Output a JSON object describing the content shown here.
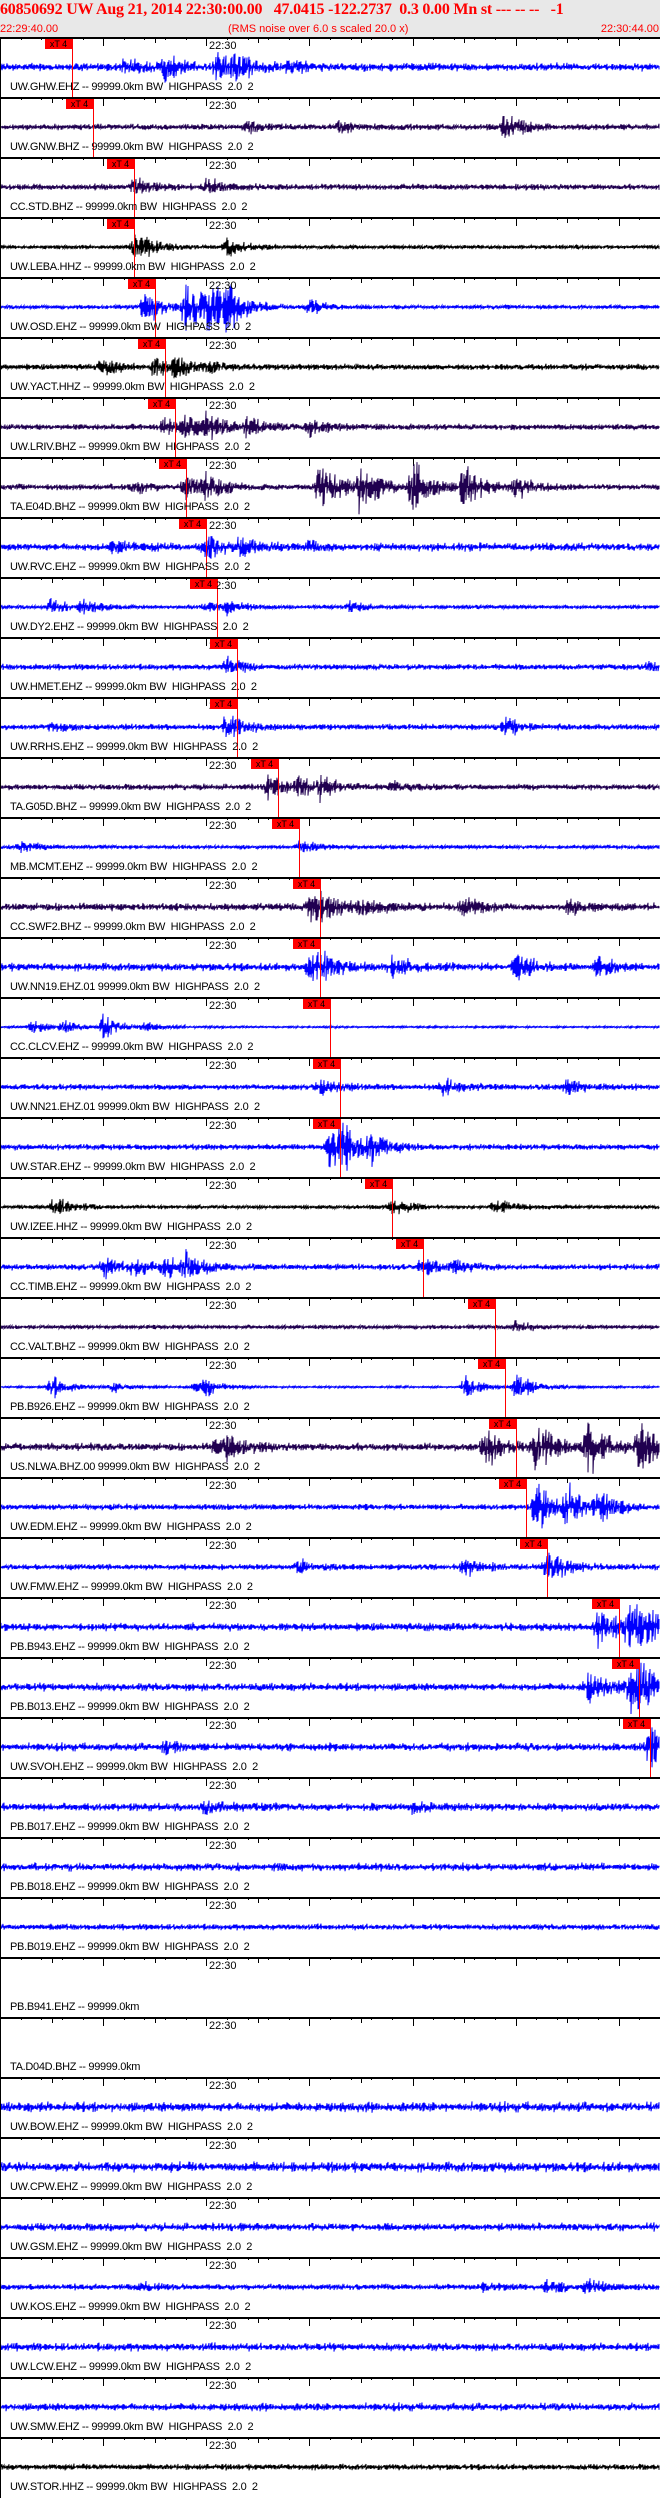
{
  "header": {
    "title": "60850692 UW Aug 21, 2014 22:30:00.00   47.0415 -122.2737  0.3 0.00 Mn st --- -- --   -1",
    "start_time": "22:29:40.00",
    "note": "(RMS noise over 6.0 s scaled 20.0 x)",
    "end_time": "22:30:44.00"
  },
  "time_axis": {
    "span_s": 64,
    "major_label": "22:30",
    "major_label_offset_s": 20
  },
  "pick_label": "xT 4",
  "colors": {
    "blue": "#0000ff",
    "purple": "#200050",
    "black": "#000000",
    "pick": "#ff0000"
  },
  "traces": [
    {
      "label": "UW.GHW.EHZ -- 99999.0km BW  HIGHPASS  2.0  2",
      "color": "blue",
      "pick_s": 7,
      "base": 4,
      "events": [
        [
          12,
          10
        ],
        [
          16,
          12
        ],
        [
          21,
          15
        ],
        [
          23,
          12
        ],
        [
          28,
          6
        ]
      ]
    },
    {
      "label": "UW.GNW.BHZ -- 99999.0km BW  HIGHPASS  2.0  2",
      "color": "purple",
      "pick_s": 9,
      "base": 3,
      "events": [
        [
          24,
          6
        ],
        [
          33,
          6
        ],
        [
          49,
          15
        ]
      ]
    },
    {
      "label": "CC.STD.BHZ -- 99999.0km BW  HIGHPASS  2.0  2",
      "color": "purple",
      "pick_s": 13,
      "base": 3,
      "events": [
        [
          13,
          8
        ],
        [
          20,
          8
        ]
      ]
    },
    {
      "label": "UW.LEBA.HHZ -- 99999.0km BW  HIGHPASS  2.0  2",
      "color": "black",
      "pick_s": 13,
      "base": 2,
      "events": [
        [
          13,
          10
        ],
        [
          14,
          8
        ],
        [
          22,
          10
        ]
      ]
    },
    {
      "label": "UW.OSD.EHZ -- 99999.0km BW  HIGHPASS  2.0  2",
      "color": "blue",
      "pick_s": 15,
      "base": 2,
      "events": [
        [
          14,
          20
        ],
        [
          18,
          28
        ],
        [
          20,
          28
        ],
        [
          22,
          22
        ],
        [
          30,
          8
        ]
      ]
    },
    {
      "label": "UW.YACT.HHZ -- 99999.0km BW  HIGHPASS  2.0  2",
      "color": "black",
      "pick_s": 16,
      "base": 3,
      "events": [
        [
          10,
          8
        ],
        [
          15,
          10
        ],
        [
          17,
          10
        ],
        [
          20,
          5
        ]
      ]
    },
    {
      "label": "UW.LRIV.BHZ -- 99999.0km BW  HIGHPASS  2.0  2",
      "color": "purple",
      "pick_s": 17,
      "base": 3,
      "events": [
        [
          16,
          10
        ],
        [
          18,
          12
        ],
        [
          20,
          12
        ],
        [
          24,
          10
        ],
        [
          30,
          8
        ]
      ]
    },
    {
      "label": "TA.E04D.BHZ -- 99999.0km BW  HIGHPASS  2.0  2",
      "color": "purple",
      "pick_s": 18,
      "base": 3,
      "events": [
        [
          13,
          6
        ],
        [
          18,
          12
        ],
        [
          20,
          12
        ],
        [
          31,
          29
        ],
        [
          35,
          29
        ],
        [
          40,
          27
        ],
        [
          45,
          20
        ],
        [
          50,
          12
        ]
      ]
    },
    {
      "label": "UW.RVC.EHZ -- 99999.0km BW  HIGHPASS  2.0  2",
      "color": "blue",
      "pick_s": 20,
      "base": 4,
      "events": [
        [
          11,
          6
        ],
        [
          20,
          12
        ],
        [
          23,
          10
        ],
        [
          30,
          6
        ]
      ]
    },
    {
      "label": "UW.DY2.EHZ -- 99999.0km BW  HIGHPASS  2.0  2",
      "color": "blue",
      "pick_s": 21,
      "base": 2,
      "events": [
        [
          5,
          8
        ],
        [
          8,
          6
        ],
        [
          20,
          6
        ],
        [
          22,
          6
        ],
        [
          34,
          5
        ]
      ]
    },
    {
      "label": "UW.HMET.EHZ -- 99999.0km BW  HIGHPASS  2.0  2",
      "color": "blue",
      "pick_s": 23,
      "base": 3,
      "events": [
        [
          22,
          8
        ],
        [
          63,
          6
        ]
      ]
    },
    {
      "label": "UW.RRHS.EHZ -- 99999.0km BW  HIGHPASS  2.0  2",
      "color": "blue",
      "pick_s": 23,
      "base": 3,
      "events": [
        [
          5,
          5
        ],
        [
          22,
          14
        ],
        [
          49,
          8
        ]
      ]
    },
    {
      "label": "TA.G05D.BHZ -- 99999.0km BW  HIGHPASS  2.0  2",
      "color": "purple",
      "pick_s": 27,
      "base": 3,
      "events": [
        [
          26,
          10
        ],
        [
          29,
          10
        ],
        [
          31,
          10
        ],
        [
          38,
          6
        ]
      ]
    },
    {
      "label": "MB.MCMT.EHZ -- 99999.0km BW  HIGHPASS  2.0  2",
      "color": "blue",
      "pick_s": 29,
      "base": 2,
      "events": [
        [
          2,
          6
        ],
        [
          29,
          8
        ]
      ]
    },
    {
      "label": "CC.SWF2.BHZ -- 99999.0km BW  HIGHPASS  2.0  2",
      "color": "purple",
      "pick_s": 31,
      "base": 4,
      "events": [
        [
          30,
          14
        ],
        [
          31,
          14
        ],
        [
          35,
          8
        ],
        [
          45,
          10
        ],
        [
          55,
          8
        ]
      ]
    },
    {
      "label": "UW.NN19.EHZ.01 99999.0km BW  HIGHPASS  2.0  2",
      "color": "blue",
      "pick_s": 31,
      "base": 4,
      "events": [
        [
          30,
          12
        ],
        [
          31,
          12
        ],
        [
          38,
          10
        ],
        [
          50,
          14
        ],
        [
          58,
          10
        ]
      ]
    },
    {
      "label": "CC.CLCV.EHZ -- 99999.0km BW  HIGHPASS  2.0  2",
      "color": "blue",
      "pick_s": 32,
      "base": 1,
      "events": [
        [
          3,
          7
        ],
        [
          6,
          7
        ],
        [
          10,
          12
        ],
        [
          14,
          5
        ]
      ]
    },
    {
      "label": "UW.NN21.EHZ.01 99999.0km BW  HIGHPASS  2.0  2",
      "color": "blue",
      "pick_s": 33,
      "base": 3,
      "events": [
        [
          31,
          8
        ],
        [
          43,
          8
        ],
        [
          55,
          8
        ]
      ]
    },
    {
      "label": "UW.STAR.EHZ -- 99999.0km BW  HIGHPASS  2.0  2",
      "color": "blue",
      "pick_s": 33,
      "base": 3,
      "events": [
        [
          32,
          22
        ],
        [
          33,
          18
        ],
        [
          36,
          14
        ]
      ]
    },
    {
      "label": "UW.IZEE.HHZ -- 99999.0km BW  HIGHPASS  2.0  2",
      "color": "black",
      "pick_s": 38,
      "base": 2,
      "events": [
        [
          5,
          6
        ],
        [
          6,
          5
        ],
        [
          38,
          10
        ],
        [
          48,
          8
        ]
      ]
    },
    {
      "label": "CC.TIMB.EHZ -- 99999.0km BW  HIGHPASS  2.0  2",
      "color": "blue",
      "pick_s": 41,
      "base": 3,
      "events": [
        [
          10,
          10
        ],
        [
          13,
          9
        ],
        [
          16,
          10
        ],
        [
          18,
          11
        ],
        [
          41,
          10
        ],
        [
          44,
          6
        ]
      ]
    },
    {
      "label": "CC.VALT.BHZ -- 99999.0km BW  HIGHPASS  2.0  2",
      "color": "purple",
      "pick_s": 48,
      "base": 2,
      "events": [
        [
          50,
          6
        ]
      ]
    },
    {
      "label": "PB.B926.EHZ -- 99999.0km BW  HIGHPASS  2.0  2",
      "color": "blue",
      "pick_s": 49,
      "base": 1,
      "events": [
        [
          5,
          12
        ],
        [
          11,
          6
        ],
        [
          19,
          6
        ],
        [
          20,
          6
        ],
        [
          45,
          12
        ],
        [
          50,
          14
        ]
      ]
    },
    {
      "label": "US.NLWA.BHZ.00 99999.0km BW  HIGHPASS  2.0  2",
      "color": "purple",
      "pick_s": 50,
      "base": 4,
      "events": [
        [
          21,
          8
        ],
        [
          22,
          9
        ],
        [
          47,
          20
        ],
        [
          52,
          30
        ],
        [
          57,
          30
        ],
        [
          62,
          30
        ]
      ]
    },
    {
      "label": "UW.EDM.EHZ -- 99999.0km BW  HIGHPASS  2.0  2",
      "color": "blue",
      "pick_s": 51,
      "base": 3,
      "events": [
        [
          52,
          25
        ],
        [
          55,
          22
        ],
        [
          58,
          15
        ]
      ]
    },
    {
      "label": "UW.FMW.EHZ -- 99999.0km BW  HIGHPASS  2.0  2",
      "color": "blue",
      "pick_s": 53,
      "base": 3,
      "events": [
        [
          29,
          8
        ],
        [
          45,
          8
        ],
        [
          53,
          20
        ]
      ]
    },
    {
      "label": "PB.B943.EHZ -- 99999.0km BW  HIGHPASS  2.0  2",
      "color": "blue",
      "pick_s": 60,
      "base": 4,
      "events": [
        [
          58,
          20
        ],
        [
          61,
          24
        ],
        [
          62,
          24
        ]
      ]
    },
    {
      "label": "PB.B013.EHZ -- 99999.0km BW  HIGHPASS  2.0  2",
      "color": "blue",
      "pick_s": 62,
      "base": 4,
      "events": [
        [
          57,
          16
        ],
        [
          61,
          22
        ],
        [
          62,
          18
        ]
      ]
    },
    {
      "label": "UW.SVOH.EHZ -- 99999.0km BW  HIGHPASS  2.0  2",
      "color": "blue",
      "pick_s": 63,
      "base": 4,
      "events": [
        [
          16,
          6
        ],
        [
          63,
          25
        ]
      ]
    },
    {
      "label": "PB.B017.EHZ -- 99999.0km BW  HIGHPASS  2.0  2",
      "color": "blue",
      "pick_s": null,
      "base": 4,
      "events": [
        [
          20,
          7
        ],
        [
          40,
          6
        ]
      ]
    },
    {
      "label": "PB.B018.EHZ -- 99999.0km BW  HIGHPASS  2.0  2",
      "color": "blue",
      "pick_s": null,
      "base": 4,
      "events": []
    },
    {
      "label": "PB.B019.EHZ -- 99999.0km BW  HIGHPASS  2.0  2",
      "color": "blue",
      "pick_s": null,
      "base": 3,
      "events": []
    },
    {
      "label": "PB.B941.EHZ -- 99999.0km",
      "color": "blue",
      "pick_s": null,
      "base": 0,
      "events": []
    },
    {
      "label": "TA.D04D.BHZ -- 99999.0km",
      "color": "blue",
      "pick_s": null,
      "base": 0,
      "events": []
    },
    {
      "label": "UW.BOW.EHZ -- 99999.0km BW  HIGHPASS  2.0  2",
      "color": "blue",
      "pick_s": null,
      "base": 5,
      "events": []
    },
    {
      "label": "UW.CPW.EHZ -- 99999.0km BW  HIGHPASS  2.0  2",
      "color": "blue",
      "pick_s": null,
      "base": 5,
      "events": []
    },
    {
      "label": "UW.GSM.EHZ -- 99999.0km BW  HIGHPASS  2.0  2",
      "color": "blue",
      "pick_s": null,
      "base": 4,
      "events": []
    },
    {
      "label": "UW.KOS.EHZ -- 99999.0km BW  HIGHPASS  2.0  2",
      "color": "blue",
      "pick_s": null,
      "base": 3,
      "events": [
        [
          14,
          5
        ],
        [
          47,
          6
        ],
        [
          53,
          7
        ],
        [
          57,
          7
        ]
      ]
    },
    {
      "label": "UW.LCW.EHZ -- 99999.0km BW  HIGHPASS  2.0  2",
      "color": "blue",
      "pick_s": null,
      "base": 4,
      "events": []
    },
    {
      "label": "UW.SMW.EHZ -- 99999.0km BW  HIGHPASS  2.0  2",
      "color": "blue",
      "pick_s": null,
      "base": 4,
      "events": []
    },
    {
      "label": "UW.STOR.HHZ -- 99999.0km BW  HIGHPASS  2.0  2",
      "color": "black",
      "pick_s": null,
      "base": 3,
      "events": []
    }
  ]
}
